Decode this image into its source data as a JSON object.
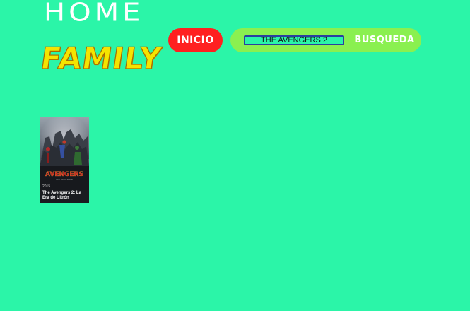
{
  "logo": {
    "line1": "HOME",
    "line2": "FAMILY"
  },
  "nav": {
    "inicio_label": "INICIO"
  },
  "search": {
    "value": "THE AVENGERS 2",
    "button_label": "BUSQUEDA"
  },
  "results": [
    {
      "year": "2015",
      "title": "The Avengers 2: La Era de Ultrón",
      "poster_brand": "AVENGERS",
      "poster_subtitle": "AGE OF ULTRON"
    }
  ],
  "colors": {
    "background": "#2bf5a8",
    "inicio_button": "#ff2020",
    "search_bar": "#8af050",
    "logo_home": "#ffffff",
    "logo_family": "#f5e400",
    "input_border": "#2a3fa0"
  }
}
